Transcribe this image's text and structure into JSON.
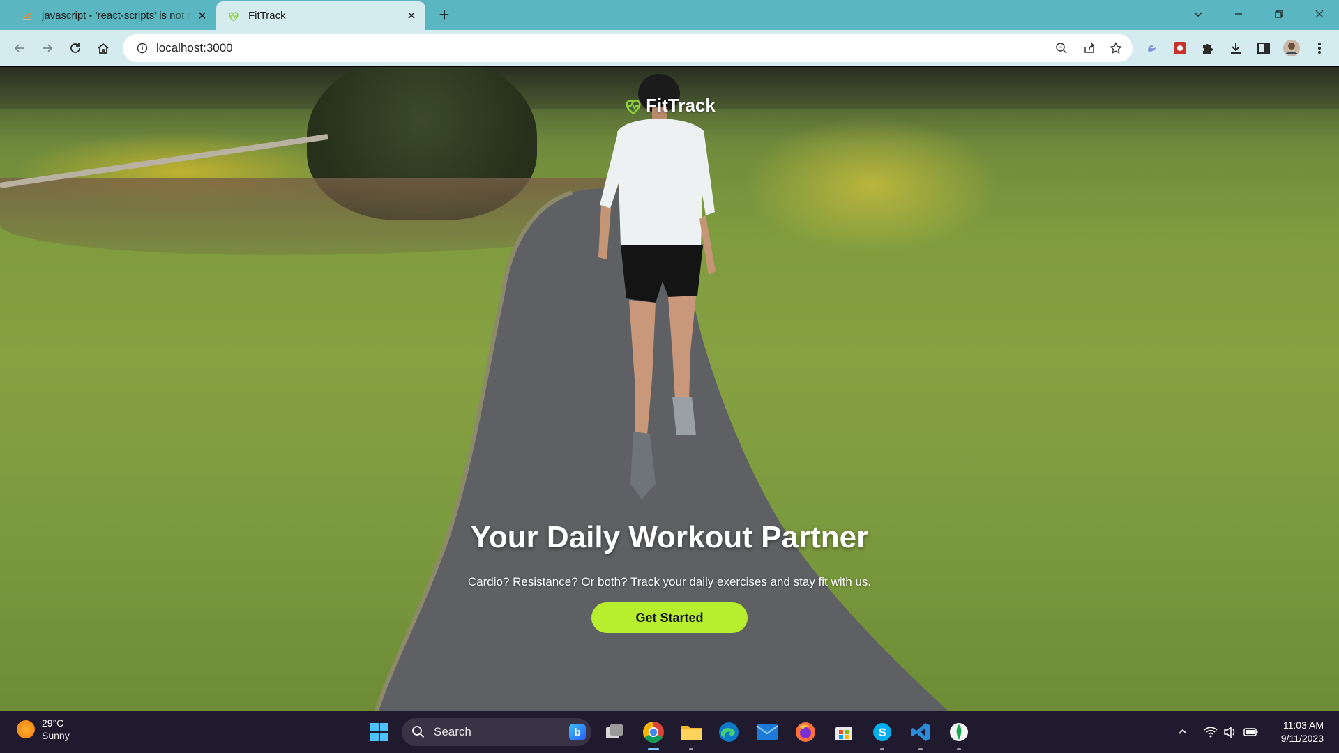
{
  "browser": {
    "tabs": [
      {
        "title": "javascript - 'react-scripts' is not r",
        "active": false
      },
      {
        "title": "FitTrack",
        "active": true
      }
    ],
    "url": "localhost:3000",
    "accent": "#5ab6c1"
  },
  "page": {
    "brand": "FitTrack",
    "hero_title": "Your Daily Workout Partner",
    "hero_subtitle": "Cardio? Resistance? Or both? Track your daily exercises and stay fit with us.",
    "cta_label": "Get Started",
    "cta_color": "#b7ef2e"
  },
  "taskbar": {
    "weather_temp": "29°C",
    "weather_desc": "Sunny",
    "search_label": "Search",
    "time": "11:03 AM",
    "date": "9/11/2023",
    "apps": [
      "windows-start",
      "task-view",
      "chrome",
      "file-explorer",
      "edge",
      "mail",
      "firefox",
      "microsoft-store",
      "skype",
      "vscode",
      "mongodb-compass"
    ]
  }
}
